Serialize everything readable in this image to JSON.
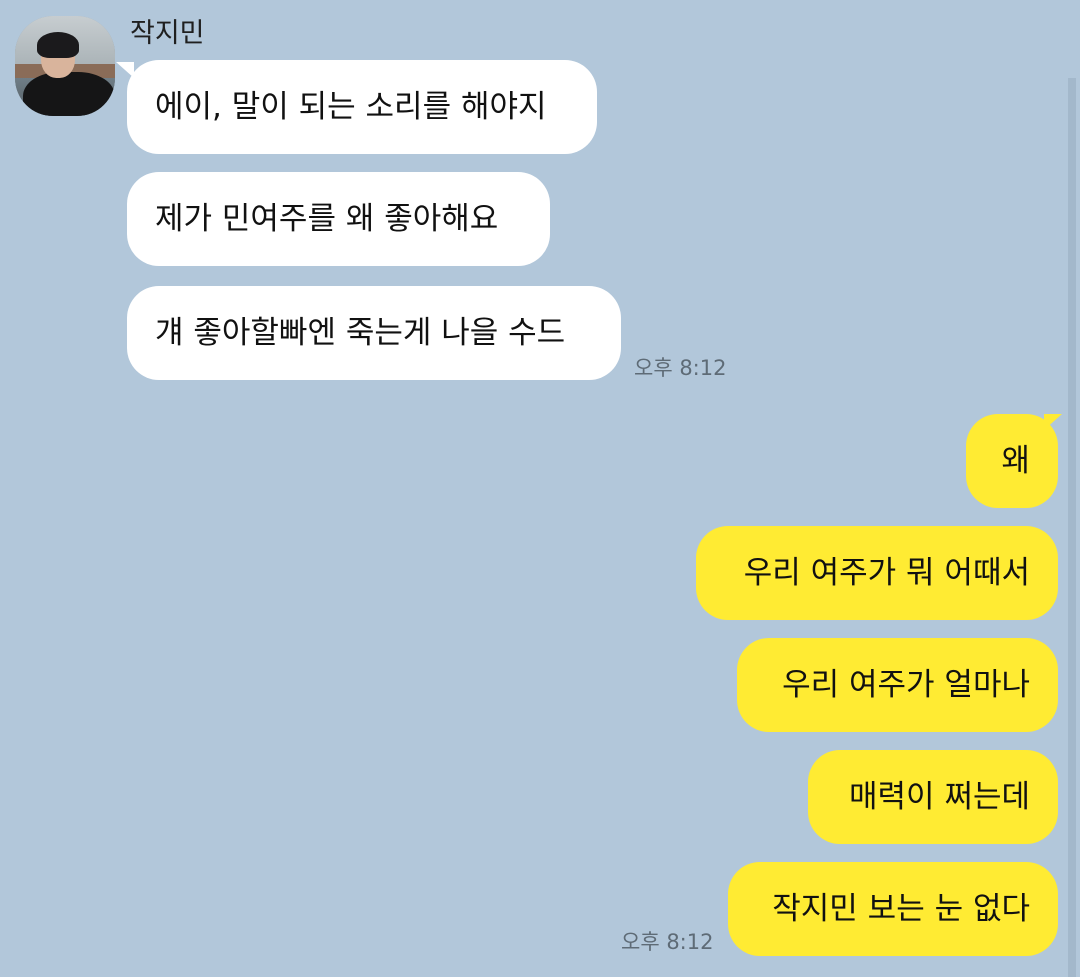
{
  "chat": {
    "sender_name": "작지민",
    "received": [
      {
        "text": "에이, 말이 되는 소리를 해야지"
      },
      {
        "text": "제가 민여주를 왜 좋아해요"
      },
      {
        "text": "걔 좋아할빠엔 죽는게 나을 수드"
      }
    ],
    "received_time": "오후 8:12",
    "sent": [
      {
        "text": "왜"
      },
      {
        "text": "우리 여주가 뭐 어때서"
      },
      {
        "text": "우리 여주가 얼마나"
      },
      {
        "text": "매력이 쩌는데"
      },
      {
        "text": "작지민 보는 눈 없다"
      }
    ],
    "sent_time": "오후 8:12"
  },
  "colors": {
    "background": "#b2c7da",
    "sent_bubble": "#ffeb33",
    "received_bubble": "#ffffff"
  }
}
